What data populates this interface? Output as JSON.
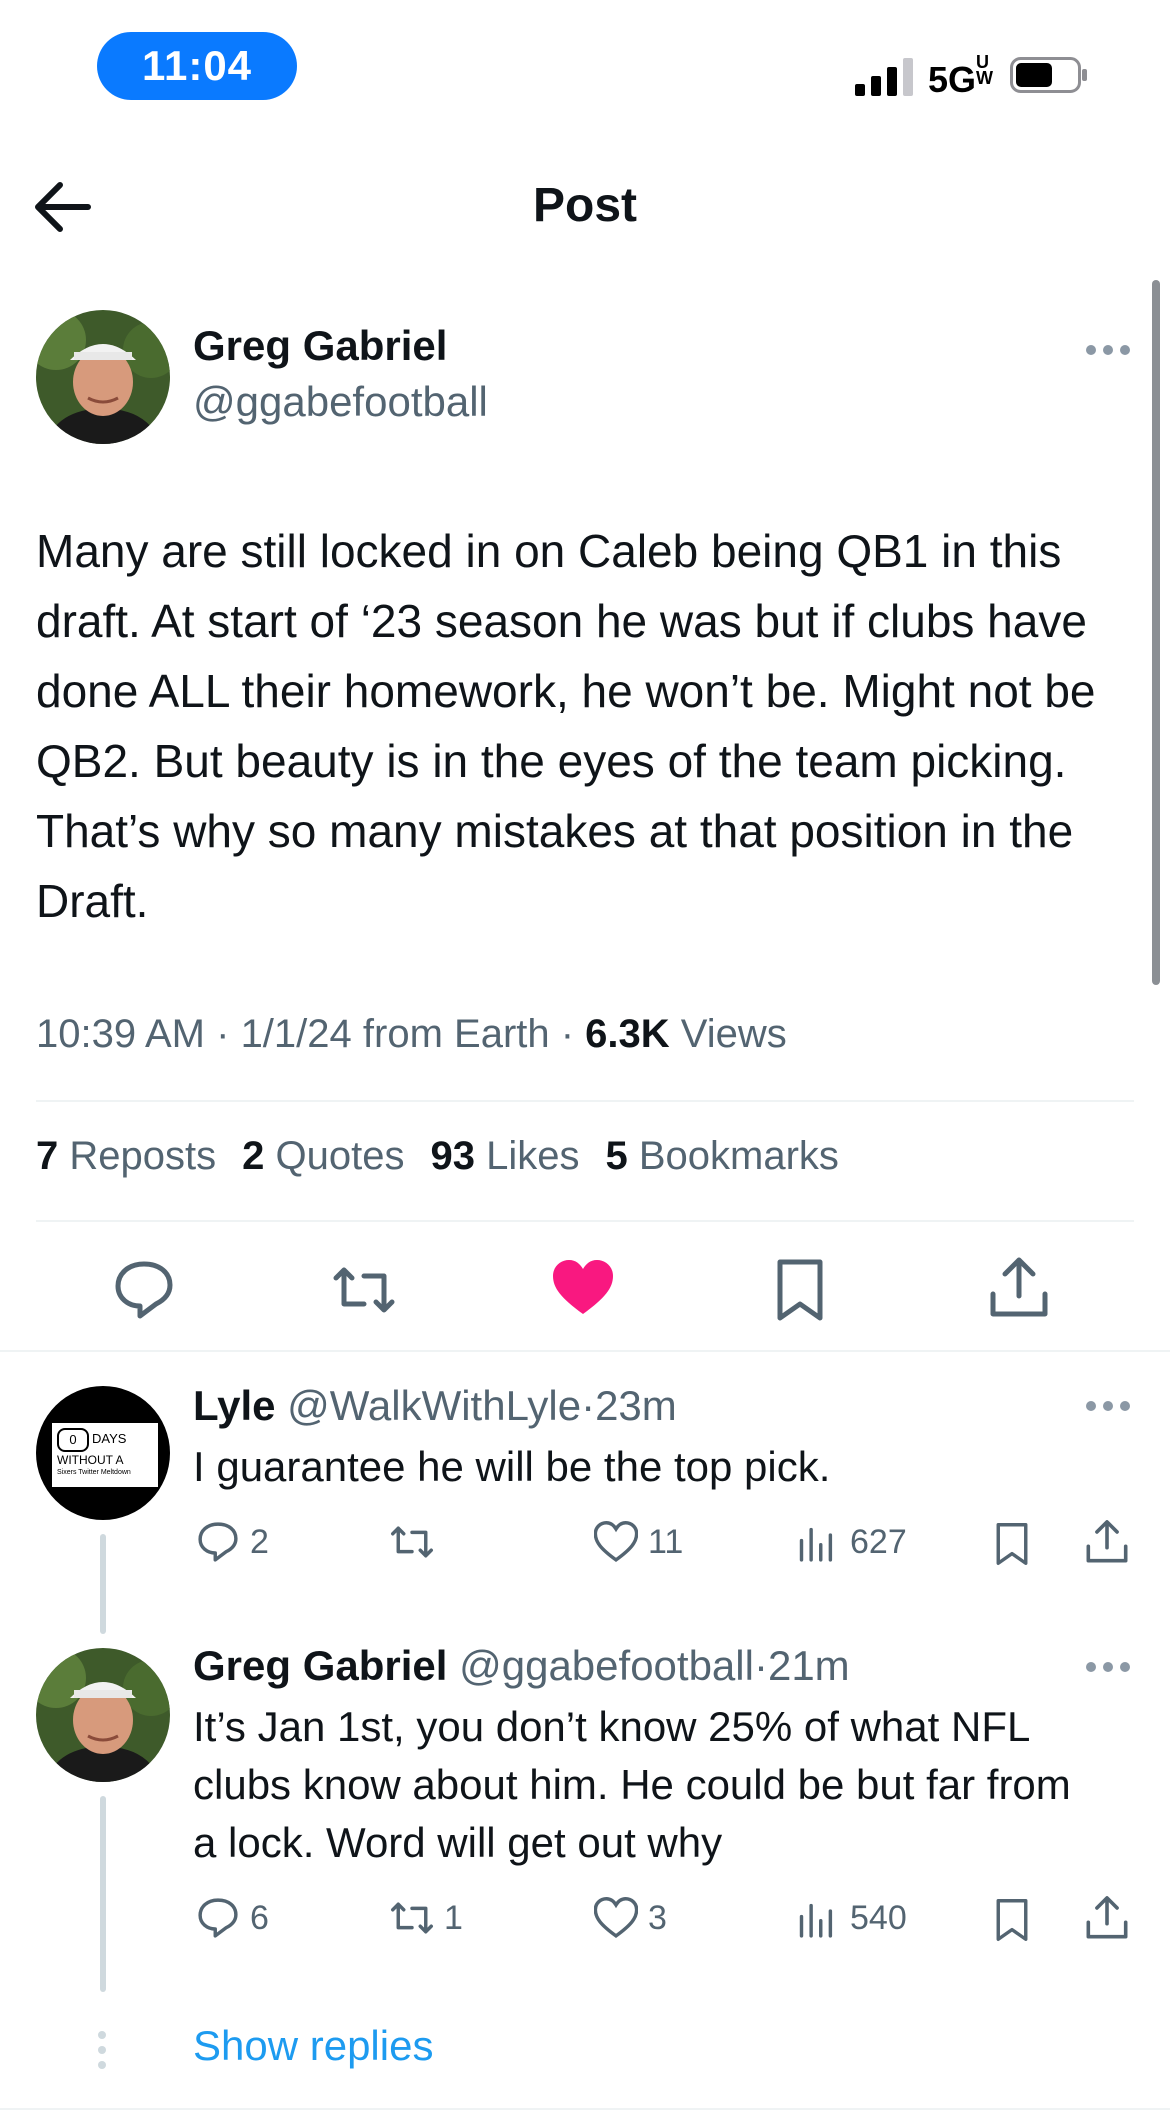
{
  "status_bar": {
    "time": "11:04",
    "network": "5G",
    "network_suffix": "UW"
  },
  "header": {
    "title": "Post"
  },
  "post": {
    "author_name": "Greg Gabriel",
    "author_handle": "@ggabefootball",
    "text": "Many are still locked in on Caleb being QB1 in this draft. At start of ‘23 season he was but if clubs have done ALL their homework, he won’t be. Might not be QB2. But beauty is in the eyes of the team picking. That’s why so many mistakes at that position in the Draft.",
    "time": "10:39 AM",
    "date": "1/1/24",
    "source": "from Earth",
    "views_count": "6.3K",
    "views_label": "Views",
    "stats": [
      {
        "count": "7",
        "label": "Reposts"
      },
      {
        "count": "2",
        "label": "Quotes"
      },
      {
        "count": "93",
        "label": "Likes"
      },
      {
        "count": "5",
        "label": "Bookmarks"
      }
    ],
    "liked": true,
    "like_color": "#f91880"
  },
  "replies": [
    {
      "name": "Lyle",
      "handle": "@WalkWithLyle",
      "time": "23m",
      "text": "I guarantee he will be the top pick.",
      "avatar_text": {
        "counter": "0",
        "line1": "DAYS",
        "line2": "WITHOUT A",
        "line3": "Sixers Twitter Meltdown"
      },
      "replies": "2",
      "reposts": "",
      "likes": "11",
      "views": "627"
    },
    {
      "name": "Greg Gabriel",
      "handle": "@ggabefootball",
      "time": "21m",
      "text": "It’s Jan 1st, you don’t know 25% of what NFL clubs know about him. He could be but far from a lock. Word will get out why",
      "replies": "6",
      "reposts": "1",
      "likes": "3",
      "views": "540"
    }
  ],
  "show_replies_label": "Show replies",
  "colors": {
    "accent": "#1d9bf0",
    "secondary_text": "#536471",
    "like": "#f91880"
  }
}
